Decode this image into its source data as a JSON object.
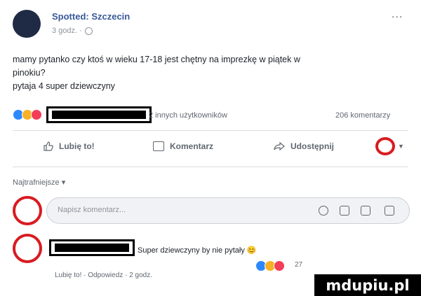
{
  "post": {
    "author_name": "Spotted: Szczecin",
    "time": "3 godz. ·",
    "text_line1": "mamy pytanko czy ktoś w wieku 17-18 jest chętny na imprezkę w piątek w",
    "text_line2": "pinokiu?",
    "text_line3": "pytaja 4 super dziewczyny",
    "reactions_text": "2 innych użytkowników",
    "comments_count": "206 komentarzy",
    "more_icon": "..."
  },
  "actions": {
    "like_label": "Lubię to!",
    "comment_label": "Komentarz",
    "share_label": "Udostępnij"
  },
  "comments": {
    "sort_label": "Najtrafniejsze ▾",
    "input_placeholder": "Napisz komentarz...",
    "reply_text": "Super dziewczyny by nie pytały 😊",
    "reply_reaction_count": "27",
    "reply_actions": "Lubię to! · Odpowiedz · 2 godz."
  },
  "watermark": "mdupiu.pl",
  "colors": {
    "accent": "#385898",
    "highlight": "#d81b21"
  }
}
